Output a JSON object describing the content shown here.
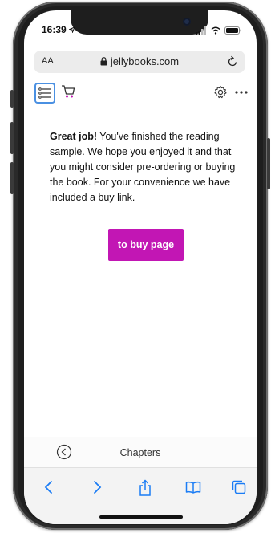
{
  "status_bar": {
    "time": "16:39"
  },
  "browser": {
    "text_size_label": "AA",
    "url": "jellybooks.com"
  },
  "reader": {
    "message_bold": "Great job!",
    "message_rest": " You've finished the reading sample. We hope you enjoyed it and that you might consider pre-ordering or buying the book. For your convenience we have included a buy link.",
    "buy_button_label": "to buy page",
    "chapters_label": "Chapters"
  },
  "colors": {
    "accent": "#c216b4",
    "focus_border": "#4a90e2",
    "safari_blue": "#1a7cf5"
  },
  "icons": {
    "toolbar": [
      "table-of-contents-icon",
      "shopping-cart-icon",
      "gear-icon",
      "more-icon"
    ],
    "safari": [
      "back-arrow-icon",
      "forward-arrow-icon",
      "share-icon",
      "bookmarks-icon",
      "tabs-icon"
    ]
  }
}
